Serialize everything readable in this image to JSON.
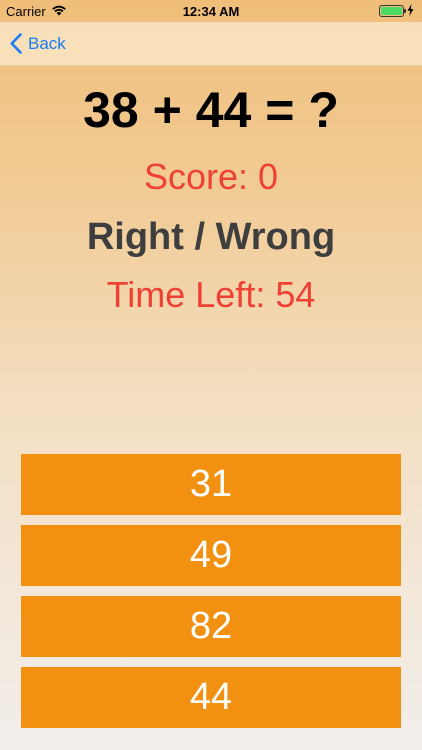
{
  "status_bar": {
    "carrier": "Carrier",
    "time": "12:34 AM",
    "battery_level": 1.0
  },
  "nav": {
    "back_label": "Back"
  },
  "game": {
    "equation": "38 + 44 = ?",
    "score": "Score: 0",
    "result": "Right / Wrong",
    "time_left": "Time Left: 54"
  },
  "answers": [
    "31",
    "49",
    "82",
    "44"
  ],
  "colors": {
    "accent": "#F29111",
    "link": "#1A7CF5",
    "score_text": "#EE4134",
    "result_text": "#3E3E3E"
  }
}
